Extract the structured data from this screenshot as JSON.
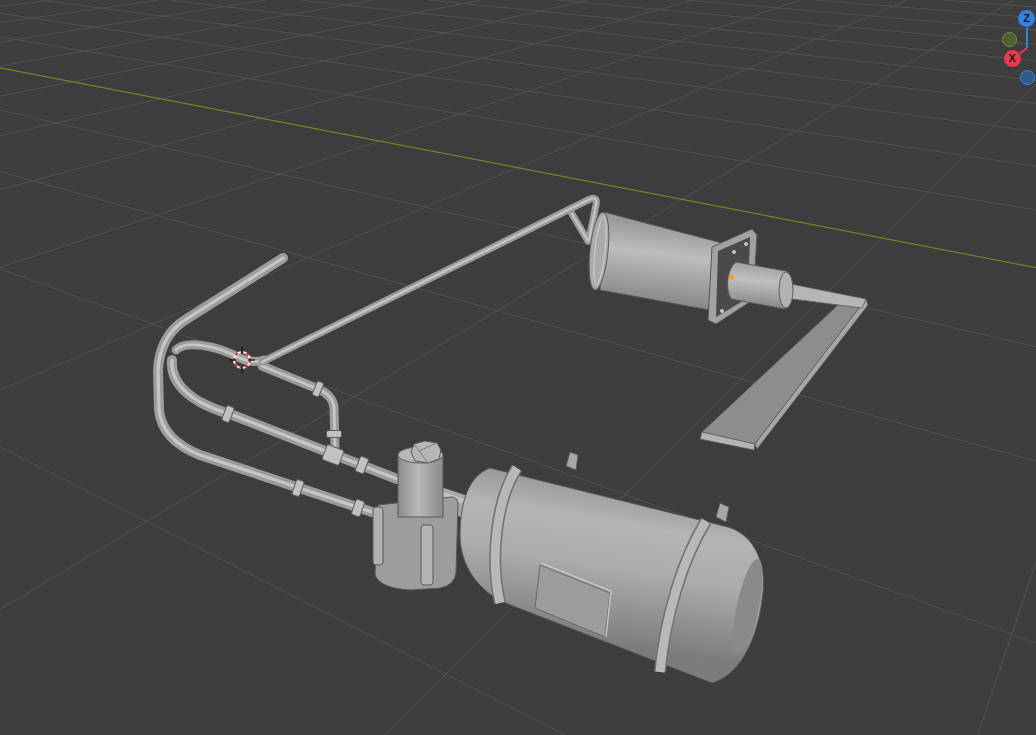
{
  "viewport": {
    "gizmo": {
      "axes": [
        {
          "kind": "positive",
          "label": "Z",
          "color": "#2f83e4"
        },
        {
          "kind": "negative",
          "color": "#4f6030"
        },
        {
          "kind": "positive",
          "label": "X",
          "color": "#ee3650"
        },
        {
          "kind": "negative",
          "color": "#2c5b8e"
        }
      ]
    }
  }
}
